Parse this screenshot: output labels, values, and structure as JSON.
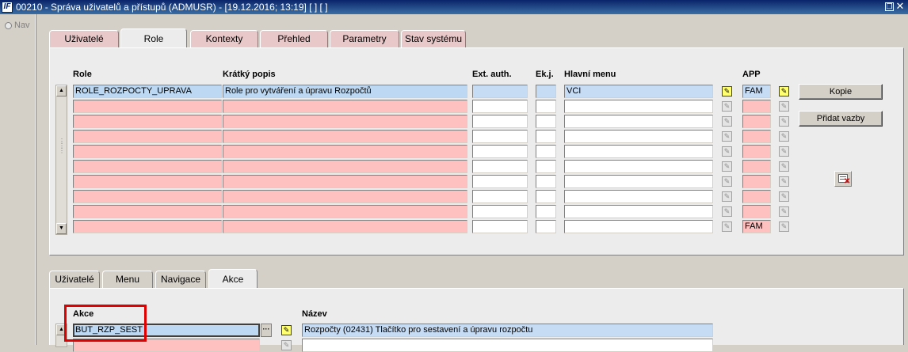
{
  "window": {
    "app_icon": "IF",
    "title": "00210 - Správa uživatelů a přístupů (ADMUSR) - [19.12.2016; 13:19] [ ] [ ]",
    "restore_icon": "restore-icon",
    "close_icon": "close-icon"
  },
  "leftnav": {
    "label": "Nav"
  },
  "top_tabs": [
    {
      "label": "Uživatelé",
      "active": false,
      "color": "pink"
    },
    {
      "label": "Role",
      "active": true
    },
    {
      "label": "Kontexty",
      "active": false,
      "color": "pink"
    },
    {
      "label": "Přehled",
      "active": false,
      "color": "pink"
    },
    {
      "label": "Parametry",
      "active": false,
      "color": "pink"
    },
    {
      "label": "Stav systému",
      "active": false,
      "color": "pink"
    }
  ],
  "roles_grid": {
    "headers": {
      "role": "Role",
      "description": "Krátký popis",
      "ext_auth": "Ext. auth.",
      "ekj": "Ek.j.",
      "main_menu": "Hlavní menu",
      "app": "APP"
    },
    "first_row": {
      "role": "ROLE_ROZPOCTY_UPRAVA",
      "description": "Role pro vytváření a úpravu Rozpočtů",
      "ext_auth": "",
      "ekj": "",
      "main_menu": "VCI",
      "app": "FAM"
    },
    "last_row_app": "FAM",
    "row_count": 10
  },
  "buttons": {
    "copy": "Kopie",
    "add_links": "Přidat vazby"
  },
  "bottom_tabs": [
    {
      "label": "Uživatelé",
      "active": false
    },
    {
      "label": "Menu",
      "active": false
    },
    {
      "label": "Navigace",
      "active": false
    },
    {
      "label": "Akce",
      "active": true
    }
  ],
  "actions_grid": {
    "headers": {
      "action": "Akce",
      "name": "Název"
    },
    "first_row": {
      "action": "BUT_RZP_SEST",
      "name": "Rozpočty (02431) Tlačítko pro sestavení a úpravu rozpočtu"
    },
    "ellipsis": "···"
  },
  "colors": {
    "required_field": "#ffc0c0",
    "selected_row": "#bcd8f2",
    "highlight": "#e00000",
    "title_bar": "#0a246a"
  }
}
